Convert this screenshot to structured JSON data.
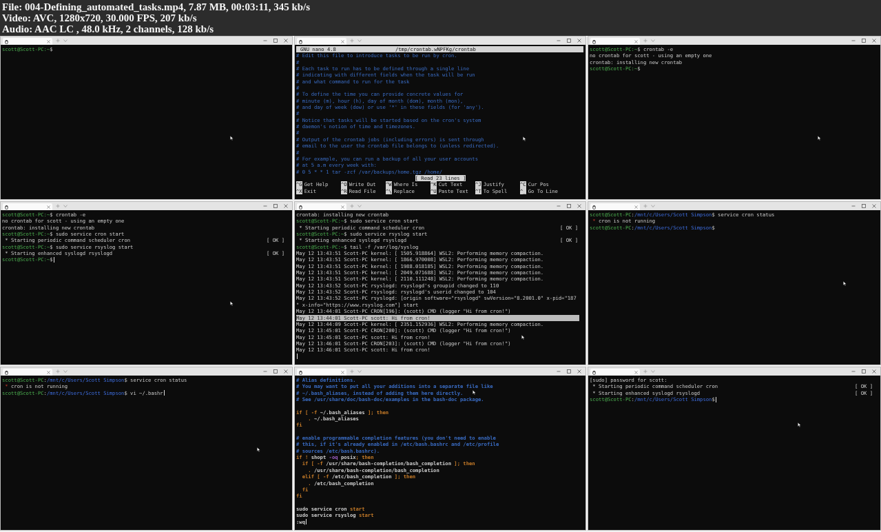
{
  "info": [
    "File: 004-Defining_automated_tasks.mp4, 7.87 MB, 00:03:11, 345 kb/s",
    "Video: AVC, 1280x720, 30.000 FPS, 207 kb/s",
    "Audio: AAC LC , 48.0 kHz, 2 channels, 128 kb/s"
  ],
  "panels": [
    {
      "kind": "terminal",
      "lines": [
        {
          "kind": "line",
          "parts": [
            {
              "kind": "prompt",
              "text": "scott@Scott-PC:~"
            },
            {
              "kind": "text",
              "text": "$"
            }
          ]
        }
      ]
    },
    {
      "kind": "nano",
      "header": {
        "version": "GNU nano 4.8",
        "file": "/tmp/crontab.wNPFKg/crontab"
      },
      "lines": [
        {
          "kind": "line",
          "parts": [
            {
              "kind": "comment",
              "text": "# Edit this file to introduce tasks to be run by cron."
            }
          ]
        },
        {
          "kind": "line",
          "parts": [
            {
              "kind": "comment",
              "text": "#"
            }
          ]
        },
        {
          "kind": "line",
          "parts": [
            {
              "kind": "comment",
              "text": "# Each task to run has to be defined through a single line"
            }
          ]
        },
        {
          "kind": "line",
          "parts": [
            {
              "kind": "comment",
              "text": "# indicating with different fields when the task will be run"
            }
          ]
        },
        {
          "kind": "line",
          "parts": [
            {
              "kind": "comment",
              "text": "# and what command to run for the task"
            }
          ]
        },
        {
          "kind": "line",
          "parts": [
            {
              "kind": "comment",
              "text": "#"
            }
          ]
        },
        {
          "kind": "line",
          "parts": [
            {
              "kind": "comment",
              "text": "# To define the time you can provide concrete values for"
            }
          ]
        },
        {
          "kind": "line",
          "parts": [
            {
              "kind": "comment",
              "text": "# minute (m), hour (h), day of month (dom), month (mon),"
            }
          ]
        },
        {
          "kind": "line",
          "parts": [
            {
              "kind": "comment",
              "text": "# and day of week (dow) or use '*' in these fields (for 'any')."
            }
          ]
        },
        {
          "kind": "line",
          "parts": [
            {
              "kind": "comment",
              "text": "#"
            }
          ]
        },
        {
          "kind": "line",
          "parts": [
            {
              "kind": "comment",
              "text": "# Notice that tasks will be started based on the cron's system"
            }
          ]
        },
        {
          "kind": "line",
          "parts": [
            {
              "kind": "comment",
              "text": "# daemon's notion of time and timezones."
            }
          ]
        },
        {
          "kind": "line",
          "parts": [
            {
              "kind": "comment",
              "text": "#"
            }
          ]
        },
        {
          "kind": "line",
          "parts": [
            {
              "kind": "comment",
              "text": "# Output of the crontab jobs (including errors) is sent through"
            }
          ]
        },
        {
          "kind": "line",
          "parts": [
            {
              "kind": "comment",
              "text": "# email to the user the crontab file belongs to (unless redirected)."
            }
          ]
        },
        {
          "kind": "line",
          "parts": [
            {
              "kind": "comment",
              "text": "#"
            }
          ]
        },
        {
          "kind": "line",
          "parts": [
            {
              "kind": "comment",
              "text": "# For example, you can run a backup of all your user accounts"
            }
          ]
        },
        {
          "kind": "line",
          "parts": [
            {
              "kind": "comment",
              "text": "# at 5 a.m every week with:"
            }
          ]
        },
        {
          "kind": "line",
          "parts": [
            {
              "kind": "comment",
              "text": "# 0 5 * * 1 tar -zcf /var/backups/home.tgz /home/"
            }
          ]
        }
      ],
      "message": "[ Read 23 lines ]",
      "shortcuts": [
        [
          {
            "key": "^G",
            "label": "Get Help"
          },
          {
            "key": "^O",
            "label": "Write Out"
          },
          {
            "key": "^W",
            "label": "Where Is"
          },
          {
            "key": "^K",
            "label": "Cut Text"
          },
          {
            "key": "^J",
            "label": "Justify"
          },
          {
            "key": "^C",
            "label": "Cur Pos"
          }
        ],
        [
          {
            "key": "^X",
            "label": "Exit"
          },
          {
            "key": "^R",
            "label": "Read File"
          },
          {
            "key": "^\\",
            "label": "Replace"
          },
          {
            "key": "^U",
            "label": "Paste Text"
          },
          {
            "key": "^T",
            "label": "To Spell"
          },
          {
            "key": "^_",
            "label": "Go To Line"
          }
        ]
      ]
    },
    {
      "kind": "terminal",
      "lines": [
        {
          "kind": "line",
          "parts": [
            {
              "kind": "prompt",
              "text": "scott@Scott-PC:~"
            },
            {
              "kind": "text",
              "text": "$ crontab -e"
            }
          ]
        },
        {
          "kind": "line",
          "parts": [
            {
              "kind": "text",
              "text": "no crontab for scott - using an empty one"
            }
          ]
        },
        {
          "kind": "line",
          "parts": [
            {
              "kind": "text",
              "text": "crontab: installing new crontab"
            }
          ]
        },
        {
          "kind": "line",
          "parts": [
            {
              "kind": "prompt",
              "text": "scott@Scott-PC:~"
            },
            {
              "kind": "text",
              "text": "$"
            }
          ]
        }
      ]
    },
    {
      "kind": "terminal",
      "lines": [
        {
          "kind": "line",
          "parts": [
            {
              "kind": "prompt",
              "text": "scott@Scott-PC:~"
            },
            {
              "kind": "text",
              "text": "$ crontab -e"
            }
          ]
        },
        {
          "kind": "line",
          "parts": [
            {
              "kind": "text",
              "text": "no crontab for scott - using an empty one"
            }
          ]
        },
        {
          "kind": "line",
          "parts": [
            {
              "kind": "text",
              "text": "crontab: installing new crontab"
            }
          ]
        },
        {
          "kind": "line",
          "parts": [
            {
              "kind": "prompt",
              "text": "scott@Scott-PC:~"
            },
            {
              "kind": "text",
              "text": "$ sudo service cron start"
            }
          ]
        },
        {
          "kind": "line",
          "parts": [
            {
              "kind": "text",
              "text": " * Starting periodic command scheduler cron"
            }
          ],
          "status": "[ OK ]"
        },
        {
          "kind": "line",
          "parts": [
            {
              "kind": "prompt",
              "text": "scott@Scott-PC:~"
            },
            {
              "kind": "text",
              "text": "$ sudo service rsyslog start"
            }
          ]
        },
        {
          "kind": "line",
          "parts": [
            {
              "kind": "text",
              "text": " * Starting enhanced syslogd rsyslogd"
            }
          ],
          "status": "[ OK ]"
        },
        {
          "kind": "line",
          "parts": [
            {
              "kind": "prompt",
              "text": "scott@Scott-PC:~"
            },
            {
              "kind": "text",
              "text": "$"
            }
          ],
          "cursor": true
        }
      ]
    },
    {
      "kind": "terminal",
      "lines": [
        {
          "kind": "line",
          "parts": [
            {
              "kind": "text",
              "text": "crontab: installing new crontab"
            }
          ]
        },
        {
          "kind": "line",
          "parts": [
            {
              "kind": "prompt",
              "text": "scott@Scott-PC:~"
            },
            {
              "kind": "text",
              "text": "$ sudo service cron start"
            }
          ]
        },
        {
          "kind": "line",
          "parts": [
            {
              "kind": "text",
              "text": " * Starting periodic command scheduler cron"
            }
          ],
          "status": "[ OK ]"
        },
        {
          "kind": "line",
          "parts": [
            {
              "kind": "prompt",
              "text": "scott@Scott-PC:~"
            },
            {
              "kind": "text",
              "text": "$ sudo service rsyslog start"
            }
          ]
        },
        {
          "kind": "line",
          "parts": [
            {
              "kind": "text",
              "text": " * Starting enhanced syslogd rsyslogd"
            }
          ],
          "status": "[ OK ]"
        },
        {
          "kind": "line",
          "parts": [
            {
              "kind": "prompt",
              "text": "scott@Scott-PC:~"
            },
            {
              "kind": "text",
              "text": "$ tail -f /var/log/syslog"
            }
          ]
        },
        {
          "kind": "line",
          "parts": [
            {
              "kind": "text",
              "text": "May 12 13:43:51 Scott-PC kernel: [ 1505.918864] WSL2: Performing memory compaction."
            }
          ]
        },
        {
          "kind": "line",
          "parts": [
            {
              "kind": "text",
              "text": "May 12 13:43:51 Scott-PC kernel: [ 1866.970008] WSL2: Performing memory compaction."
            }
          ]
        },
        {
          "kind": "line",
          "parts": [
            {
              "kind": "text",
              "text": "May 12 13:43:51 Scott-PC kernel: [ 1988.018185] WSL2: Performing memory compaction."
            }
          ]
        },
        {
          "kind": "line",
          "parts": [
            {
              "kind": "text",
              "text": "May 12 13:43:51 Scott-PC kernel: [ 2049.071688] WSL2: Performing memory compaction."
            }
          ]
        },
        {
          "kind": "line",
          "parts": [
            {
              "kind": "text",
              "text": "May 12 13:43:51 Scott-PC kernel: [ 2110.111248] WSL2: Performing memory compaction."
            }
          ]
        },
        {
          "kind": "line",
          "parts": [
            {
              "kind": "text",
              "text": "May 12 13:43:52 Scott-PC rsyslogd: rsyslogd's groupid changed to 110"
            }
          ]
        },
        {
          "kind": "line",
          "parts": [
            {
              "kind": "text",
              "text": "May 12 13:43:52 Scott-PC rsyslogd: rsyslogd's userid changed to 104"
            }
          ]
        },
        {
          "kind": "line",
          "parts": [
            {
              "kind": "text",
              "text": "May 12 13:43:52 Scott-PC rsyslogd: [origin software=\"rsyslogd\" swVersion=\"8.2001.0\" x-pid=\"187"
            }
          ]
        },
        {
          "kind": "line",
          "parts": [
            {
              "kind": "text",
              "text": "\" x-info=\"https://www.rsyslog.com\"] start"
            }
          ]
        },
        {
          "kind": "line",
          "parts": [
            {
              "kind": "text",
              "text": "May 12 13:44:01 Scott-PC CRON[196]: (scott) CMD (logger \"Hi from cron!\")"
            }
          ]
        },
        {
          "kind": "line",
          "parts": [
            {
              "kind": "text",
              "text": "May 12 13:44:01 Scott-PC scott: Hi from cron!"
            }
          ],
          "highlighted": true
        },
        {
          "kind": "line",
          "parts": [
            {
              "kind": "text",
              "text": "May 12 13:44:09 Scott-PC kernel: [ 2351.152936] WSL2: Performing memory compaction."
            }
          ]
        },
        {
          "kind": "line",
          "parts": [
            {
              "kind": "text",
              "text": "May 12 13:45:01 Scott-PC CRON[200]: (scott) CMD (logger \"Hi from cron!\")"
            }
          ]
        },
        {
          "kind": "line",
          "parts": [
            {
              "kind": "text",
              "text": "May 12 13:45:01 Scott-PC scott: Hi from cron!"
            }
          ]
        },
        {
          "kind": "line",
          "parts": [
            {
              "kind": "text",
              "text": "May 12 13:46:01 Scott-PC CRON[203]: (scott) CMD (logger \"Hi from cron!\")"
            }
          ]
        },
        {
          "kind": "line",
          "parts": [
            {
              "kind": "text",
              "text": "May 12 13:46:01 Scott-PC scott: Hi from cron!"
            }
          ]
        },
        {
          "kind": "blank",
          "cursor": true
        }
      ]
    },
    {
      "kind": "terminal",
      "lines": [
        {
          "kind": "line",
          "parts": [
            {
              "kind": "prompt",
              "text": "scott@Scott-PC"
            },
            {
              "kind": "text",
              "text": ":"
            },
            {
              "kind": "path",
              "text": "/mnt/c/Users/Scott Simpson"
            },
            {
              "kind": "text",
              "text": "$ service cron status"
            }
          ]
        },
        {
          "kind": "line",
          "parts": [
            {
              "kind": "alert",
              "text": " * "
            },
            {
              "kind": "text",
              "text": "cron is not running"
            }
          ]
        },
        {
          "kind": "line",
          "parts": [
            {
              "kind": "prompt",
              "text": "scott@Scott-PC"
            },
            {
              "kind": "text",
              "text": ":"
            },
            {
              "kind": "path",
              "text": "/mnt/c/Users/Scott Simpson"
            },
            {
              "kind": "text",
              "text": "$"
            }
          ]
        }
      ]
    },
    {
      "kind": "terminal",
      "lines": [
        {
          "kind": "line",
          "parts": [
            {
              "kind": "prompt",
              "text": "scott@Scott-PC"
            },
            {
              "kind": "text",
              "text": ":"
            },
            {
              "kind": "path",
              "text": "/mnt/c/Users/Scott Simpson"
            },
            {
              "kind": "text",
              "text": "$ service cron status"
            }
          ]
        },
        {
          "kind": "line",
          "parts": [
            {
              "kind": "alert",
              "text": " * "
            },
            {
              "kind": "text",
              "text": "cron is not running"
            }
          ]
        },
        {
          "kind": "line",
          "parts": [
            {
              "kind": "prompt",
              "text": "scott@Scott-PC"
            },
            {
              "kind": "text",
              "text": ":"
            },
            {
              "kind": "path",
              "text": "/mnt/c/Users/Scott Simpson"
            },
            {
              "kind": "text",
              "text": "$ vi ~/.bashr"
            }
          ],
          "cursor": true
        }
      ]
    },
    {
      "kind": "vim",
      "lines": [
        {
          "kind": "line",
          "parts": [
            {
              "kind": "comment",
              "text": "# Alias definitions."
            }
          ]
        },
        {
          "kind": "line",
          "parts": [
            {
              "kind": "comment",
              "text": "# You may want to put all your additions into a separate file like"
            }
          ]
        },
        {
          "kind": "line",
          "parts": [
            {
              "kind": "comment",
              "text": "# ~/.bash_aliases, instead of adding them here directly."
            }
          ]
        },
        {
          "kind": "line",
          "parts": [
            {
              "kind": "comment",
              "text": "# See /usr/share/doc/bash-doc/examples in the bash-doc package."
            }
          ]
        },
        {
          "kind": "blank"
        },
        {
          "kind": "line",
          "parts": [
            {
              "kind": "keyword",
              "text": "if [ -f "
            },
            {
              "kind": "text",
              "text": "~/.bash_aliases "
            },
            {
              "kind": "keyword",
              "text": "]; then"
            }
          ]
        },
        {
          "kind": "line",
          "parts": [
            {
              "kind": "keyword",
              "text": "    . "
            },
            {
              "kind": "text",
              "text": "~/.bash_aliases"
            }
          ]
        },
        {
          "kind": "line",
          "parts": [
            {
              "kind": "keyword",
              "text": "fi"
            }
          ]
        },
        {
          "kind": "blank"
        },
        {
          "kind": "line",
          "parts": [
            {
              "kind": "comment",
              "text": "# enable programmable completion features (you don't need to enable"
            }
          ]
        },
        {
          "kind": "line",
          "parts": [
            {
              "kind": "comment",
              "text": "# this, if it's already enabled in /etc/bash.bashrc and /etc/profile"
            }
          ]
        },
        {
          "kind": "line",
          "parts": [
            {
              "kind": "comment",
              "text": "# sources /etc/bash.bashrc)."
            }
          ]
        },
        {
          "kind": "line",
          "parts": [
            {
              "kind": "keyword",
              "text": "if ! "
            },
            {
              "kind": "text",
              "text": "shopt "
            },
            {
              "kind": "option",
              "text": "-oq "
            },
            {
              "kind": "text",
              "text": "posix"
            },
            {
              "kind": "keyword",
              "text": "; then"
            }
          ]
        },
        {
          "kind": "line",
          "parts": [
            {
              "kind": "keyword",
              "text": "  if [ -f "
            },
            {
              "kind": "text",
              "text": "/usr/share/bash-completion/bash_completion "
            },
            {
              "kind": "keyword",
              "text": "]; then"
            }
          ]
        },
        {
          "kind": "line",
          "parts": [
            {
              "kind": "keyword",
              "text": "    . "
            },
            {
              "kind": "text",
              "text": "/usr/share/bash-completion/bash_completion"
            }
          ]
        },
        {
          "kind": "line",
          "parts": [
            {
              "kind": "keyword",
              "text": "  elif [ -f "
            },
            {
              "kind": "text",
              "text": "/etc/bash_completion "
            },
            {
              "kind": "keyword",
              "text": "]; then"
            }
          ]
        },
        {
          "kind": "line",
          "parts": [
            {
              "kind": "keyword",
              "text": "    . "
            },
            {
              "kind": "text",
              "text": "/etc/bash_completion"
            }
          ]
        },
        {
          "kind": "line",
          "parts": [
            {
              "kind": "keyword",
              "text": "  fi"
            }
          ]
        },
        {
          "kind": "line",
          "parts": [
            {
              "kind": "keyword",
              "text": "fi"
            }
          ]
        },
        {
          "kind": "blank"
        },
        {
          "kind": "line",
          "parts": [
            {
              "kind": "text",
              "text": "sudo service cron "
            },
            {
              "kind": "keyword",
              "text": "start"
            }
          ]
        },
        {
          "kind": "line",
          "parts": [
            {
              "kind": "text",
              "text": "sudo service rsyslog "
            },
            {
              "kind": "keyword",
              "text": "start"
            }
          ]
        },
        {
          "kind": "line",
          "parts": [
            {
              "kind": "text",
              "text": ":wq"
            }
          ],
          "cursor": true
        }
      ]
    },
    {
      "kind": "terminal",
      "lines": [
        {
          "kind": "line",
          "parts": [
            {
              "kind": "text",
              "text": "[sudo] password for scott:"
            }
          ]
        },
        {
          "kind": "line",
          "parts": [
            {
              "kind": "text",
              "text": " * Starting periodic command scheduler cron"
            }
          ],
          "status": "[ OK ]"
        },
        {
          "kind": "line",
          "parts": [
            {
              "kind": "text",
              "text": " * Starting enhanced syslogd rsyslogd"
            }
          ],
          "status": "[ OK ]"
        },
        {
          "kind": "line",
          "parts": [
            {
              "kind": "prompt",
              "text": "scott@Scott-PC"
            },
            {
              "kind": "text",
              "text": ":"
            },
            {
              "kind": "path",
              "text": "/mnt/c/Users/Scott Simpson"
            },
            {
              "kind": "text",
              "text": "$"
            }
          ],
          "cursor": true
        }
      ]
    }
  ]
}
